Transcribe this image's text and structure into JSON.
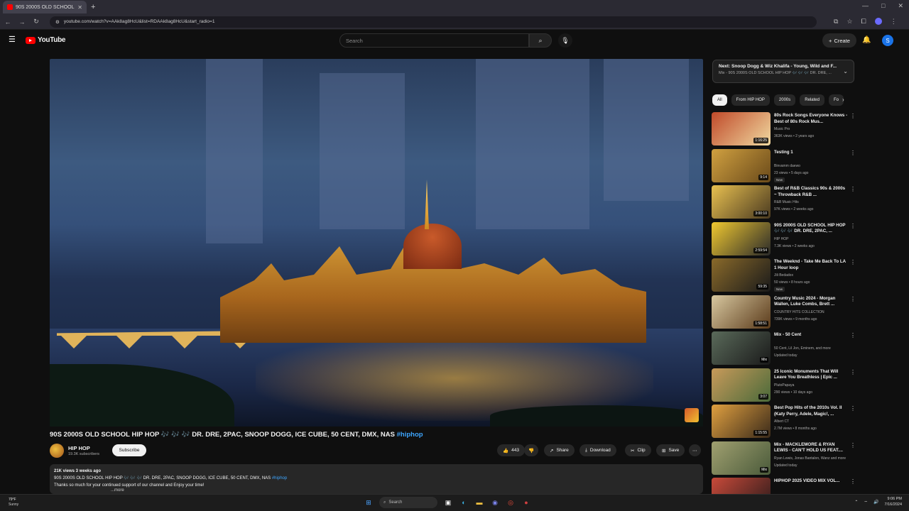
{
  "browser": {
    "tab_title": "90S 2000S OLD SCHOOL H",
    "url": "youtube.com/watch?v=AAk8ag8HcU&list=RDAAk8ag8HcU&start_radio=1"
  },
  "header": {
    "logo_text": "YouTube",
    "search_placeholder": "Search",
    "create_label": "Create",
    "avatar_letter": "S"
  },
  "video": {
    "title": "90S 2000S OLD SCHOOL HIP HOP 🎶 🎶 🎶 DR. DRE, 2PAC, SNOOP DOGG, ICE CUBE, 50 CENT, DMX, NAS",
    "hashtag": "#hiphop",
    "channel_name": "HIP HOP",
    "subscribers": "19.3K subscribers",
    "subscribe_label": "Subscribe",
    "likes": "443",
    "share_label": "Share",
    "download_label": "Download",
    "clip_label": "Clip",
    "save_label": "Save",
    "description": {
      "meta": "21K views  3 weeks ago",
      "line1": "90S 2000S OLD SCHOOL HIP HOP 🎶 🎶 🎶 DR. DRE, 2PAC, SNOOP DOGG, ICE CUBE, 50 CENT, DMX, NAS",
      "line1_tag": "#hiphop",
      "line2": "Thanks so much for your continued support of our channel and Enjoy your time!",
      "more": "...more"
    }
  },
  "next_up": {
    "title": "Next: Snoop Dogg & Wiz Khalifa - Young, Wild and F...",
    "subtitle": "Mix - 90S 2000S OLD SCHOOL HIP HOP 🎶 🎶 🎶 DR. DRE, ..."
  },
  "chips": [
    "All",
    "From HIP HOP",
    "2000s",
    "Related",
    "Fo"
  ],
  "recommendations": [
    {
      "title": "80s Rock Songs Everyone Knows - Best of 80s Rock Mus...",
      "channel": "Music Pro",
      "meta": "363K views • 2 years ago",
      "duration": "1:16:25",
      "badge": "",
      "color1": "#c04a2a",
      "color2": "#f0d9a0"
    },
    {
      "title": "Testing 1",
      "channel": "Binvamm daewo",
      "meta": "23 views • 5 days ago",
      "duration": "9:14",
      "badge": "New",
      "color1": "#d0a040",
      "color2": "#6a4a1a"
    },
    {
      "title": "Best of R&B Classics 90s & 2000s ~ Throwback R&B ...",
      "channel": "R&B Music Hits",
      "meta": "97K views • 2 weeks ago",
      "duration": "3:00:10",
      "badge": "",
      "color1": "#e8c050",
      "color2": "#4a3a20"
    },
    {
      "title": "90S 2000S OLD SCHOOL HIP HOP 🎶 🎶 🎶 DR. DRE, 2PAC, ...",
      "channel": "HIP HOP",
      "meta": "7.3K views • 2 weeks ago",
      "duration": "2:59:54",
      "badge": "",
      "color1": "#f0c830",
      "color2": "#2a2a2a"
    },
    {
      "title": "The Weeknd - Take Me Back To LA 1 Hour loop",
      "channel": "Jili Bedadox",
      "meta": "50 views • 8 hours ago",
      "duration": "59:35",
      "badge": "New",
      "color1": "#8a6a2a",
      "color2": "#1a1a1a"
    },
    {
      "title": "Country Music 2024 - Morgan Wallen, Luke Combs, Brett ...",
      "channel": "COUNTRY HITS COLLECTION",
      "meta": "739K views • 9 months ago",
      "duration": "1:58:51",
      "badge": "",
      "color1": "#d8c8a0",
      "color2": "#5a3a1a"
    },
    {
      "title": "Mix - 50 Cent",
      "channel": "50 Cent, Lil Jon, Eminem, and more",
      "meta": "Updated today",
      "duration": "Mix",
      "badge": "",
      "color1": "#5a6a5a",
      "color2": "#1a1a1a"
    },
    {
      "title": "25 Iconic Monuments That Will Leave You Breathless | Epic ...",
      "channel": "PlutoPapaya",
      "meta": "290 views • 10 days ago",
      "duration": "3:07",
      "badge": "",
      "color1": "#c89a5a",
      "color2": "#4a6a3a"
    },
    {
      "title": "Best Pop Hits of the 2010s Vol. II (Katy Perry, Adele, Magic!, ...",
      "channel": "Albert CT",
      "meta": "2.7M views • 8 months ago",
      "duration": "1:15:55",
      "badge": "",
      "color1": "#e0a040",
      "color2": "#3a2a1a"
    },
    {
      "title": "Mix - MACKLEMORE & RYAN LEWIS - CAN'T HOLD US FEAT....",
      "channel": "Ryan Lewis, Jonas Bantalon, Wanz and more",
      "meta": "Updated today",
      "duration": "Mix",
      "badge": "",
      "color1": "#a0a070",
      "color2": "#4a5a3a"
    },
    {
      "title": "HIPHOP 2025 VIDEO MIX VOL...",
      "channel": "",
      "meta": "",
      "duration": "",
      "badge": "",
      "color1": "#c84a3a",
      "color2": "#2a1a1a"
    }
  ],
  "taskbar": {
    "weather_temp": "79°F",
    "weather_cond": "Sunny",
    "search_label": "Search",
    "time": "9:06 PM",
    "date": "7/16/2024"
  }
}
